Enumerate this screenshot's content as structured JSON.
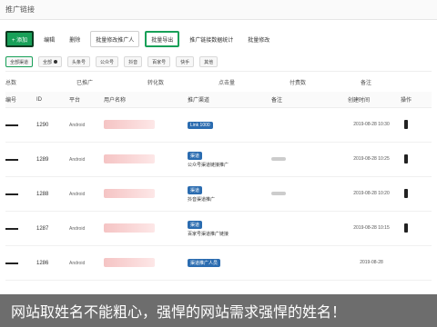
{
  "header": {
    "title": "推广链接"
  },
  "toolbar": {
    "buttons": [
      {
        "label": "+ 添加"
      },
      {
        "label": "编辑"
      },
      {
        "label": "删除"
      },
      {
        "label": "批量修改推广人"
      },
      {
        "label": "批量导出"
      },
      {
        "label": "推广链接数据统计"
      },
      {
        "label": "批量修改"
      }
    ]
  },
  "filters": [
    "全部渠道",
    "全部",
    "头条号",
    "公众号",
    "抖音",
    "百家号",
    "快手",
    "其他"
  ],
  "summary": [
    "总数",
    "已推广",
    "转化数",
    "点击量",
    "付费数",
    "备注"
  ],
  "table": {
    "headers": [
      "编号",
      "ID",
      "平台",
      "用户名称",
      "推广渠道",
      "备注",
      "创建时间",
      "操作"
    ],
    "rows": [
      {
        "id": "1290",
        "platform": "Android",
        "tag": "Link 1000",
        "channel": "",
        "date": "2019-08-28 10:30"
      },
      {
        "id": "1289",
        "platform": "Android",
        "tag": "渠道",
        "channel": "公众号渠道链接推广",
        "date": "2019-08-28 10:25"
      },
      {
        "id": "1288",
        "platform": "Android",
        "tag": "渠道",
        "channel": "抖音渠道推广",
        "date": "2019-08-28 10:20"
      },
      {
        "id": "1287",
        "platform": "Android",
        "tag": "渠道",
        "channel": "百家号渠道推广链接",
        "date": "2019-08-28 10:15"
      },
      {
        "id": "1286",
        "platform": "Android",
        "tag": "渠道推广人员",
        "channel": "",
        "date": "2019-08-28"
      }
    ]
  },
  "banner": {
    "text": "网站取姓名不能粗心，强悍的网站需求强悍的姓名！"
  }
}
